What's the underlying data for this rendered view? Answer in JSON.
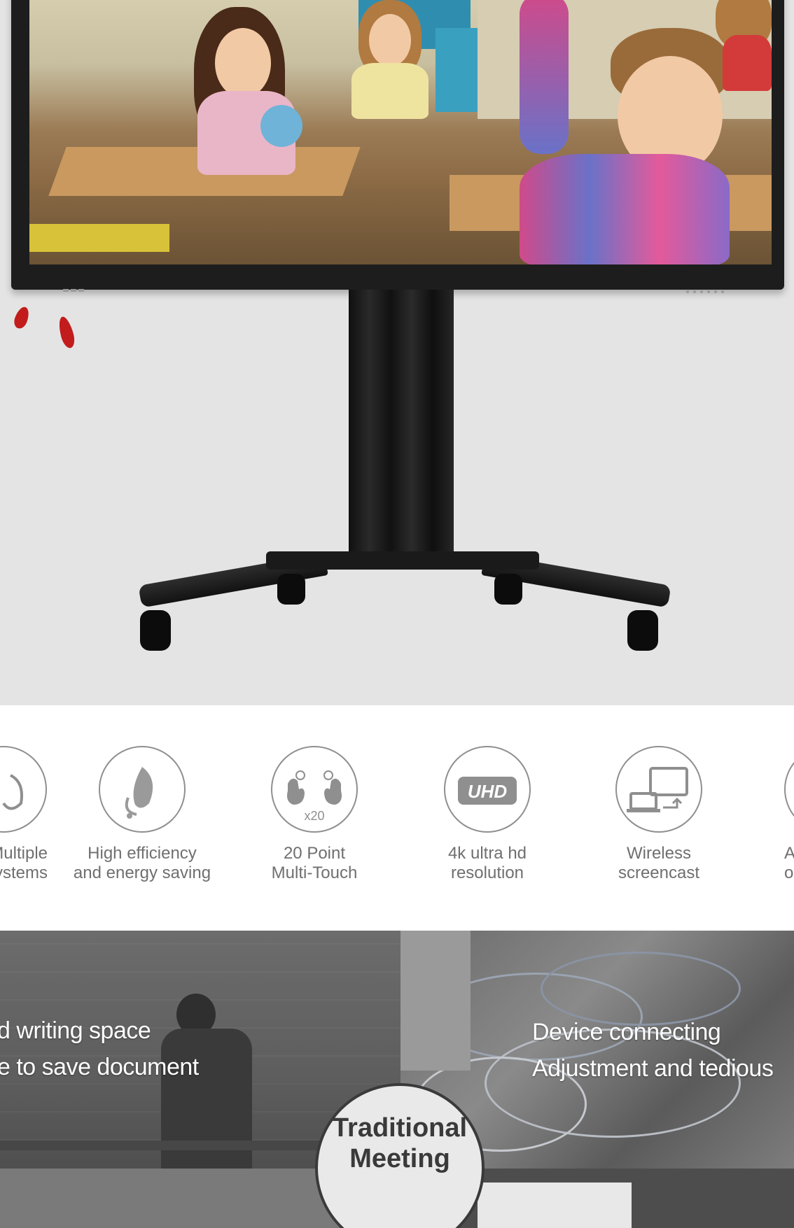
{
  "features": [
    {
      "label_line1": "Multiple",
      "label_line2": "systems",
      "icon": "hand-icon"
    },
    {
      "label_line1": "High efficiency",
      "label_line2": "and energy saving",
      "icon": "leaf-plug-icon"
    },
    {
      "label_line1": "20 Point",
      "label_line2": "Multi-Touch",
      "icon": "multi-touch-icon",
      "badge": "x20"
    },
    {
      "label_line1": "4k ultra hd",
      "label_line2": "resolution",
      "icon": "uhd-icon",
      "badge": "UHD"
    },
    {
      "label_line1": "Wireless",
      "label_line2": "screencast",
      "icon": "laptop-to-monitor-icon"
    },
    {
      "label_line1": "A",
      "label_line2": "o",
      "icon": "partial-icon"
    }
  ],
  "collage": {
    "left_line1": "d writing space",
    "left_line2": "e to save document",
    "right_line1": "Device connecting",
    "right_line2": "Adjustment and tedious",
    "badge_line1": "Traditional",
    "badge_line2": "Meeting"
  },
  "colors": {
    "hero_background": "#e4e4e4",
    "bezel": "#1d1d1d",
    "feature_text": "#6f6f6f",
    "feature_circle": "#8f8f8f",
    "badge_background": "#e9e9e9",
    "badge_text": "#3a3a3a"
  }
}
